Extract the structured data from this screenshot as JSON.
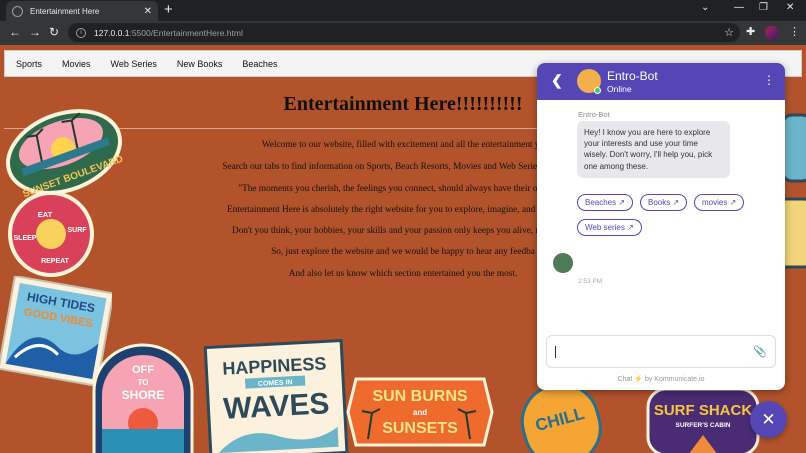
{
  "browser": {
    "tab_title": "Entertainment Here",
    "url_host": "127.0.0.1",
    "url_path": ":5500/EntertainmentHere.html"
  },
  "page": {
    "nav": [
      "Sports",
      "Movies",
      "Web Series",
      "New Books",
      "Beaches"
    ],
    "headline": "Entertainment Here!!!!!!!!!!",
    "paragraphs": [
      "Welcome to our website, filled with excitement and all the entertainment yo",
      "Search our tabs to find information on Sports, Beach Resorts, Movies and Web Series to watch, a",
      "\"The moments you cherish, the feelings you connect, should always have their own spac",
      "Entertainment Here is absolutely the right website for you to explore, imagine, and turn your b",
      "Don't you think, your hobbies, your skills and your passion only keeps you alive, rest things",
      "So, just explore the website and we would be happy to hear any feedba",
      "And also let us know which section entertained you the most."
    ],
    "stickers": {
      "sunset_boulevard": "SUNSET BOULEVARD",
      "eat": "EAT",
      "sleep": "SLEEP",
      "surf": "SURF",
      "repeat": "REPEAT",
      "high_tides": "HIGH TIDES",
      "good_vibes": "GOOD VIBES",
      "off": "OFF",
      "to": "TO",
      "shore": "SHORE",
      "happiness": "HAPPINESS",
      "comes_in": "COMES IN",
      "waves": "WAVES",
      "sun_burns": "SUN BURNS",
      "and": "and",
      "sunsets": "SUNSETS",
      "chill": "CHILL",
      "surf_shack": "SURF SHACK",
      "surfers_cabin": "SURFER'S CABIN"
    }
  },
  "chat": {
    "bot_name": "Entro-Bot",
    "status": "Online",
    "sender": "Entro-Bot",
    "message": "Hey! I know you are here to explore your interests and use your time wisely. Don't worry, I'll help you, pick one among these.",
    "quick_replies": [
      "Beaches",
      "Books",
      "movies",
      "Web series"
    ],
    "time": "2:53 PM",
    "powered_prefix": "Chat",
    "powered_suffix": "by Kommunicate.io",
    "accent_color": "#5447b5"
  }
}
